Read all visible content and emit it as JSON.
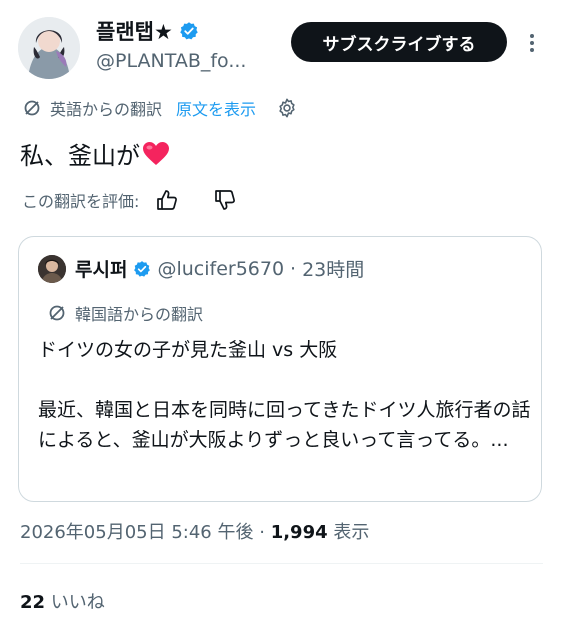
{
  "author": {
    "name": "플랜탭★",
    "handle": "@PLANTAB_fo..."
  },
  "subscribe_label": "サブスクライブする",
  "translation": {
    "label": "英語からの翻訳",
    "show_original": "原文を表示"
  },
  "tweet": {
    "text": "私、釜山が"
  },
  "rating": {
    "label": "この翻訳を評価:"
  },
  "quote": {
    "name": "루시퍼",
    "handle": "@lucifer5670",
    "separator": "·",
    "time": "23時間",
    "translation_label": "韓国語からの翻訳",
    "title": "ドイツの女の子が見た釜山 vs 大阪",
    "body": "最近、韓国と日本を同時に回ってきたドイツ人旅行者の話によると、釜山が大阪よりずっと良いって言ってる。..."
  },
  "meta": {
    "timestamp": "2026年05月05日 5:46 午後",
    "separator": "·",
    "views": "1,994",
    "views_label": "表示"
  },
  "likes": {
    "count": "22",
    "label": "いいね"
  },
  "colors": {
    "accent": "#1d9bf0",
    "verified": "#1d9bf0",
    "heart": "#f4245e",
    "text": "#0f1419",
    "muted": "#536471"
  }
}
